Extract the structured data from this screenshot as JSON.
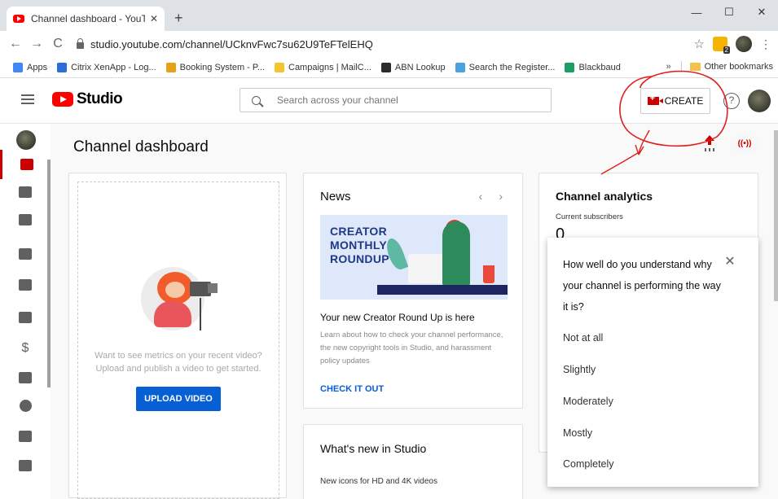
{
  "browser": {
    "tab_title": "Channel dashboard - YouTube St",
    "new_tab": "+",
    "url": "studio.youtube.com/channel/UCknvFwc7su62U9TeFTelEHQ",
    "bookmarks": [
      {
        "label": "Apps",
        "color": "#4285f4"
      },
      {
        "label": "Citrix XenApp - Log...",
        "color": "#2b6fd6"
      },
      {
        "label": "Booking System - P...",
        "color": "#e2a21a"
      },
      {
        "label": "Campaigns | MailC...",
        "color": "#f4c531"
      },
      {
        "label": "ABN Lookup",
        "color": "#2a2a2a"
      },
      {
        "label": "Search the Register...",
        "color": "#4aa3df"
      },
      {
        "label": "Blackbaud",
        "color": "#1aa067"
      }
    ],
    "more_bookmarks": "»",
    "other_bookmarks": "Other bookmarks"
  },
  "header": {
    "logo_text": "Studio",
    "search_placeholder": "Search across your channel",
    "create_label": "CREATE",
    "help": "?"
  },
  "sidebar": {
    "items": [
      {
        "name": "dashboard",
        "icon": "dashboard-icon"
      },
      {
        "name": "content",
        "icon": "video-library-icon"
      },
      {
        "name": "playlists",
        "icon": "playlist-icon"
      },
      {
        "name": "analytics",
        "icon": "analytics-icon"
      },
      {
        "name": "comments",
        "icon": "comments-icon"
      },
      {
        "name": "subtitles",
        "icon": "subtitles-icon"
      },
      {
        "name": "monetization",
        "icon": "dollar-icon",
        "glyph": "$"
      },
      {
        "name": "audio-library",
        "icon": "audio-library-icon"
      },
      {
        "name": "settings",
        "icon": "gear-icon"
      },
      {
        "name": "feedback",
        "icon": "feedback-icon"
      },
      {
        "name": "creator-studio-classic",
        "icon": "exit-icon"
      }
    ]
  },
  "main": {
    "title": "Channel dashboard",
    "live_icon": "((•))",
    "upload_card": {
      "text_line1": "Want to see metrics on your recent video?",
      "text_line2": "Upload and publish a video to get started.",
      "button": "UPLOAD VIDEO"
    },
    "news": {
      "title": "News",
      "prev": "‹",
      "next": "›",
      "image_text": [
        "CREATOR",
        "MONTHLY",
        "ROUNDUP"
      ],
      "headline": "Your new Creator Round Up is here",
      "body": "Learn about how to check your channel performance, the new copyright tools in Studio, and harassment policy updates",
      "link": "CHECK IT OUT"
    },
    "whats_new": {
      "title": "What's new in Studio",
      "item": "New icons for HD and 4K videos"
    },
    "analytics": {
      "title": "Channel analytics",
      "subscribers_label": "Current subscribers",
      "subscribers_value": "0"
    }
  },
  "survey": {
    "question": "How well do you understand why your channel is performing the way it is?",
    "close": "✕",
    "options": [
      "Not at all",
      "Slightly",
      "Moderately",
      "Mostly",
      "Completely"
    ]
  },
  "colors": {
    "accent_red": "#cc0000",
    "link_blue": "#065fd4",
    "annotation_red": "#e0201c"
  }
}
